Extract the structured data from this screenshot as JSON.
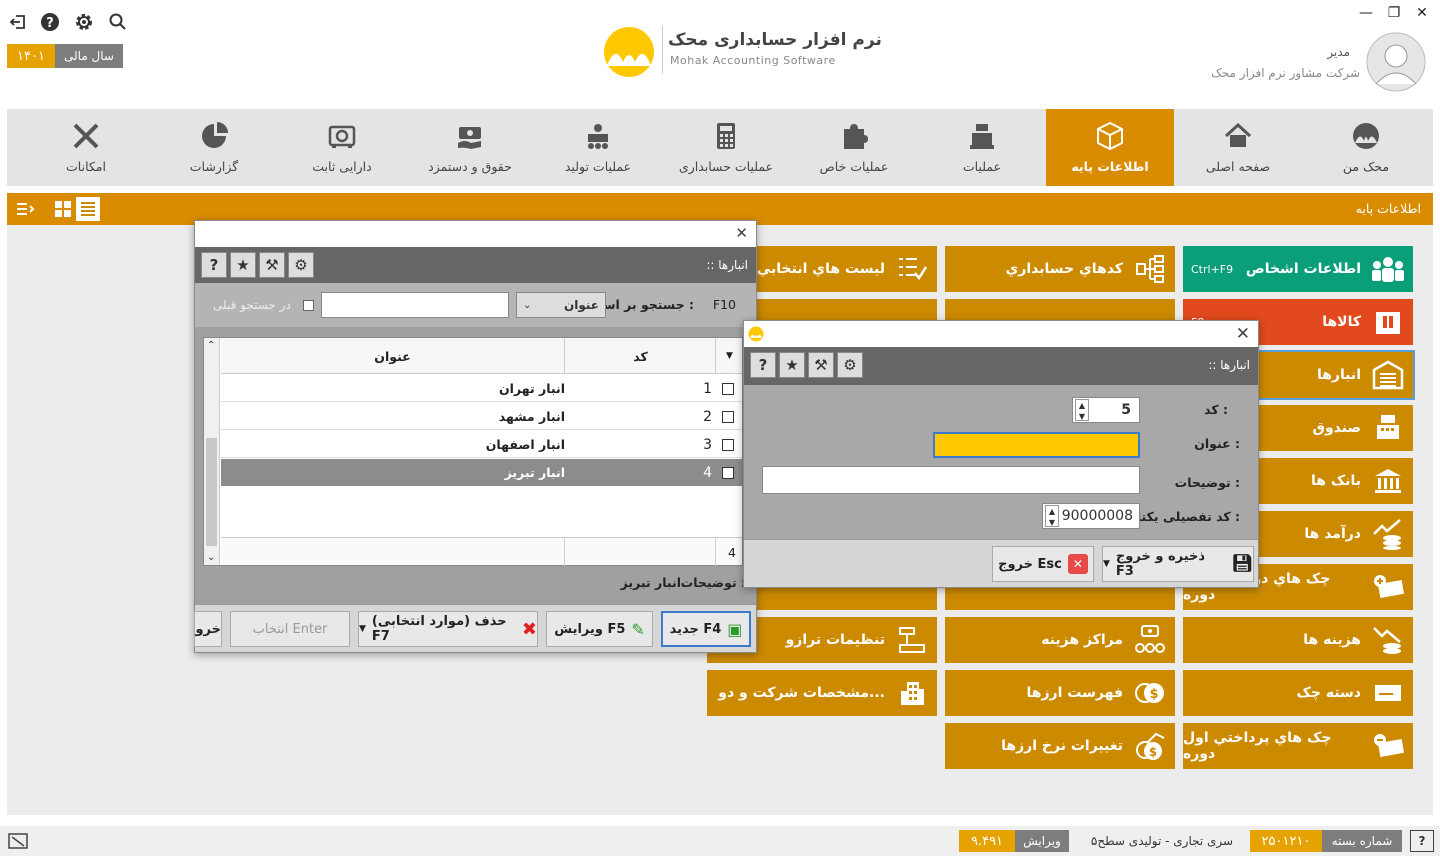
{
  "app": {
    "fiscal_year_label": "سال مالی",
    "fiscal_year_value": "۱۴۰۱",
    "logo_title": "نرم افزار حسابداری محک",
    "logo_subtitle": "Mohak Accounting Software",
    "user_name": "مدیر",
    "user_company": "شرکت مشاور نرم افزار محک"
  },
  "menu": [
    {
      "label": "محک من",
      "icon": "mohak-icon"
    },
    {
      "label": "صفحه اصلی",
      "icon": "home-icon"
    },
    {
      "label": "اطلاعات پایه",
      "icon": "box-icon"
    },
    {
      "label": "عملیات",
      "icon": "cash-register-icon"
    },
    {
      "label": "عملیات خاص",
      "icon": "puzzle-icon"
    },
    {
      "label": "عملیات حسابداری",
      "icon": "calculator-icon"
    },
    {
      "label": "عملیات تولید",
      "icon": "factory-icon"
    },
    {
      "label": "حقوق و دستمزد",
      "icon": "payroll-icon"
    },
    {
      "label": "دارایی ثابت",
      "icon": "safe-icon"
    },
    {
      "label": "گزارشات",
      "icon": "report-icon"
    },
    {
      "label": "امکانات",
      "icon": "tools-icon"
    }
  ],
  "subbar_title": "اطلاعات پایه",
  "tiles": {
    "c1": [
      {
        "label": "اطلاعات اشخاص",
        "shortcut": "Ctrl+F9",
        "icon": "people-icon"
      },
      {
        "label": "کالاها",
        "shortcut": "F8",
        "icon": "goods-icon"
      },
      {
        "label": "انبارها",
        "icon": "warehouse-icon"
      },
      {
        "label": "صندوق",
        "icon": "cashbox-icon"
      },
      {
        "label": "بانک ها",
        "icon": "bank-icon"
      },
      {
        "label": "درآمد ها",
        "icon": "income-icon"
      },
      {
        "label": "چک هاي دريافتي اول دوره",
        "icon": "cheque-in-icon"
      },
      {
        "label": "هزينه ها",
        "icon": "expense-icon"
      },
      {
        "label": "دسته چک",
        "icon": "chequebook-icon"
      },
      {
        "label": "چک هاي پرداختي اول دوره",
        "icon": "cheque-out-icon"
      }
    ],
    "c2": [
      {
        "label": "کدهاي حسابداري",
        "icon": "tree-icon"
      },
      {
        "label": "مراکز هزینه",
        "icon": "cost-center-icon"
      },
      {
        "label": "فهرست ارزها",
        "icon": "currency-icon"
      },
      {
        "label": "تغییرات نرخ ارزها",
        "icon": "currency-rate-icon"
      }
    ],
    "c3": [
      {
        "label": "ليست هاي انتخابي",
        "icon": "checklist-icon"
      },
      {
        "label": "تنظیمات ترازو",
        "icon": "scale-icon"
      },
      {
        "label": "مشخصات شرکت و دو...",
        "icon": "building-icon"
      }
    ]
  },
  "list_dialog": {
    "title": ":: انبارها",
    "search_prefix": "F10",
    "search_label": "جستجو بر اساس :",
    "search_field": "عنوان",
    "search_in_results": "در جستجو قبلی",
    "col_code": "کد",
    "col_title": "عنوان",
    "rows": [
      {
        "code": "1",
        "title": "انبار تهران"
      },
      {
        "code": "2",
        "title": "انبار مشهد"
      },
      {
        "code": "3",
        "title": "انبار اصفهان"
      },
      {
        "code": "4",
        "title": "انبار تبریز"
      }
    ],
    "footer_count": "4",
    "desc_label": "توضیحات :",
    "desc_value": "انبار تبریز",
    "btn_new": "جدید F4",
    "btn_edit": "ویرایش F5",
    "btn_delete": "حذف (موارد انتخابی) F7",
    "btn_select": "انتخاب Enter",
    "btn_exit": "خروج"
  },
  "edit_dialog": {
    "title": ":: انبارها",
    "code_label": "کد :",
    "code_value": "5",
    "title_label": "عنوان :",
    "title_value": "",
    "desc_label": "توضیحات :",
    "desc_value": "",
    "detail_label": "کد تفصیلی یکتا :",
    "detail_value": "90000008",
    "btn_save": "ذخیره و خروج F3",
    "btn_exit": "خروج Esc"
  },
  "status": {
    "package_label": "شماره بسته",
    "package_value": "۲۵۰۱۲۱۰",
    "edition": "سری تجاری - تولیدی سطح۵",
    "version_label": "ویرایش",
    "version_value": "۹.۴۹۱"
  },
  "colors": {
    "accent": "#d98c00",
    "tile": "#cc8a00",
    "green": "#0a9e79",
    "red": "#e24a1d",
    "highlight": "#ffc800"
  }
}
